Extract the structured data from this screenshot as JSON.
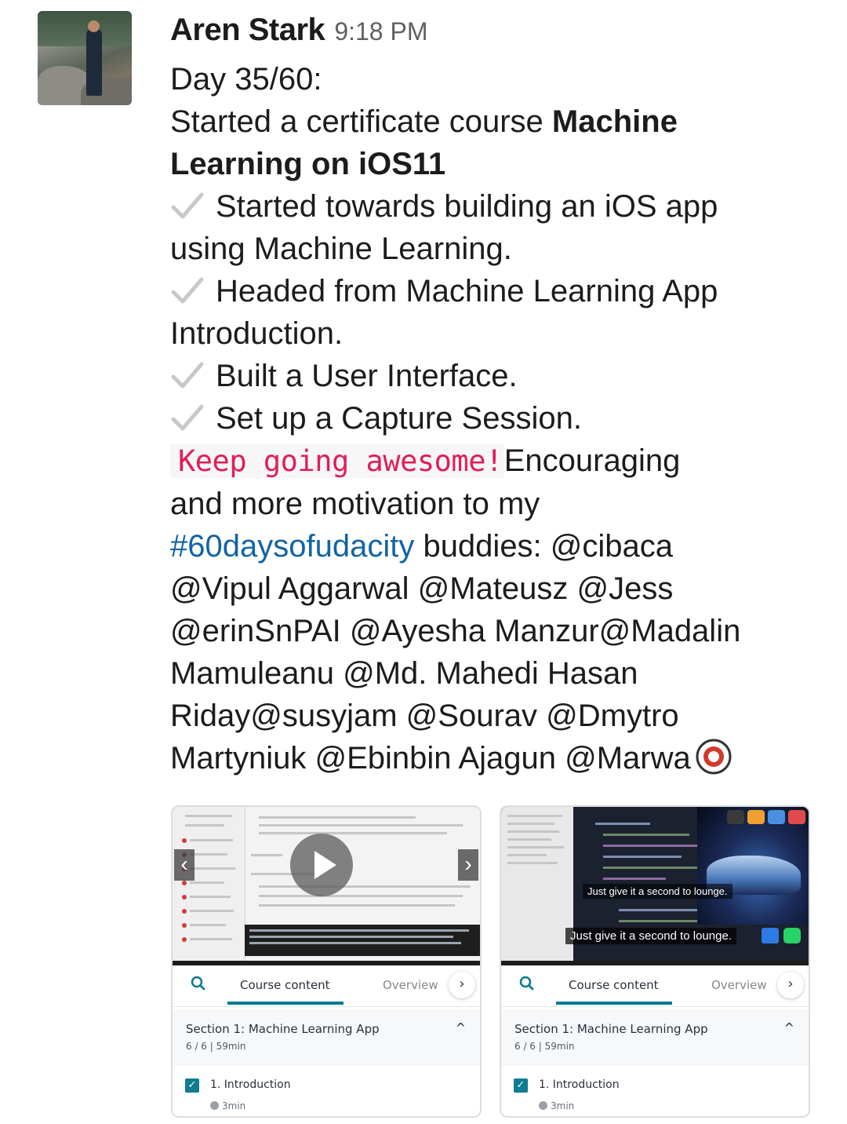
{
  "message": {
    "sender": "Aren Stark",
    "time": "9:18 PM",
    "day": "Day 35/60:",
    "intro_prefix": "Started a certificate course ",
    "course_bold_1": "Machine",
    "course_bold_2": "Learning on iOS11",
    "checks": [
      "Started towards building an iOS app",
      "using Machine Learning.",
      "Headed from Machine Learning App",
      "Introduction.",
      "Built a User Interface.",
      "Set up a Capture Session."
    ],
    "code_text": "Keep going awesome!",
    "after_code": "Encouraging",
    "line_motivation": "and more motivation to my",
    "hashtag": "#60daysofudacity",
    "after_hashtag": " buddies: @cibaca",
    "mentions": [
      "@Vipul Aggarwal @Mateusz @Jess",
      "@erinSnPAI @Ayesha Manzur@Madalin",
      "Mamuleanu @Md. Mahedi Hasan",
      "Riday@susyjam @Sourav @Dmytro",
      "Martyniuk @Ebinbin Ajagun @Marwa"
    ]
  },
  "attachments": [
    {
      "tab_course": "Course content",
      "tab_overview": "Overview",
      "section_title": "Section 1: Machine Learning App",
      "section_meta": "6 / 6 | 59min",
      "lecture_title": "1. Introduction",
      "lecture_duration": "3min"
    },
    {
      "subtitle_top": "Just give it a second to lounge.",
      "subtitle_bottom": "Just give it a second to lounge.",
      "tab_course": "Course content",
      "tab_overview": "Overview",
      "section_title": "Section 1: Machine Learning App",
      "section_meta": "6 / 6 | 59min",
      "lecture_title": "1. Introduction",
      "lecture_duration": "3min"
    }
  ],
  "colors": {
    "code_text": "#e01e5a",
    "hashtag": "#1264a3",
    "tab_underline": "#007791",
    "check_accent": "#0f7c90"
  }
}
